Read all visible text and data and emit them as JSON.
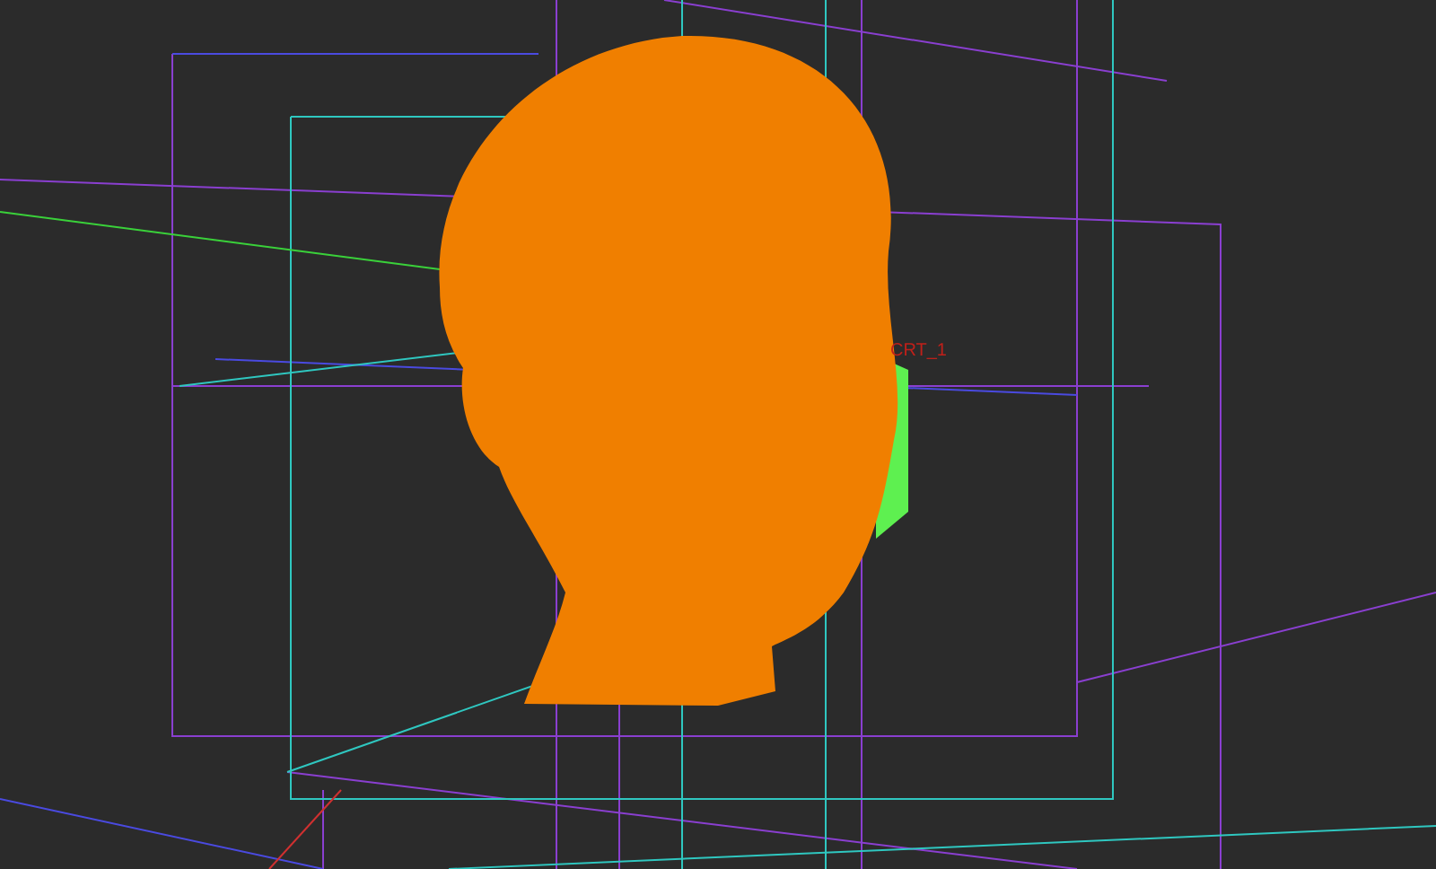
{
  "viewport": {
    "labels": [
      {
        "text": "CRT_1",
        "color": "#c0201a"
      }
    ]
  }
}
